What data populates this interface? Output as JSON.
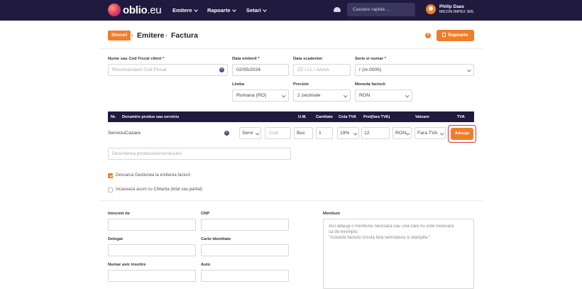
{
  "header": {
    "logo_main": "oblio",
    "logo_suffix": ".eu",
    "nav": [
      "Emitere",
      "Rapoarte",
      "Setari"
    ],
    "search_placeholder": "Cautare rapida ...",
    "user_name": "Philip Daas",
    "user_company": "MICON IMPEX SRL"
  },
  "breadcrumb": {
    "badge": "Stocuri",
    "items": [
      "Emitere",
      "Factura"
    ]
  },
  "actions": {
    "help": "?",
    "rapoarte_label": "Rapoarte"
  },
  "form": {
    "client": {
      "label": "Nume sau Cod Fiscal client *",
      "placeholder": "Recomandam Cod Fiscal"
    },
    "issue_date": {
      "label": "Data emiterii *",
      "value": "02/05/2024"
    },
    "due_date": {
      "label": "Data scadentei",
      "placeholder": "ZZ / LL / AAAA"
    },
    "series": {
      "label": "Serie si numar *",
      "value": "r (nr.0005)"
    },
    "language": {
      "label": "Limba",
      "value": "Romana (RO)"
    },
    "precision": {
      "label": "Precizie",
      "value": "2 zecimale"
    },
    "currency": {
      "label": "Moneda facturii",
      "value": "RON"
    }
  },
  "table": {
    "headers": [
      "Nr.",
      "Denumire produs sau serviciu",
      "U.M.",
      "Cantitate",
      "Cota TVA",
      "Pret(fara TVA)",
      "Valoare",
      "TVA"
    ],
    "row": {
      "name": "ServiciuCazare",
      "type": "Servi",
      "code": "Cod",
      "unit": "Buc",
      "quantity": "1",
      "vat_rate": "19%",
      "price": "12",
      "currency": "RON",
      "vat_mode": "Fara TVA",
      "add_label": "Adauga"
    },
    "description_placeholder": "Descrierea produsului/serviciului"
  },
  "options": {
    "discharge": "Descarca Gestiunea la emiterea facturii",
    "collect": "Incaseaza acum cu Chitanta (total sau partial)"
  },
  "footer": {
    "prepared_by": "Intocmit de",
    "cnp": "CNP",
    "delegate": "Delegat",
    "id_card": "Carte Identitate",
    "notice_no": "Numar aviz insotire",
    "auto": "Auto",
    "mentions_label": "Mentiuni",
    "mentions_placeholder_1": "Aici adaugi o mentiune necesara sau una care nu este necesara",
    "mentions_placeholder_2": "ca de exemplu:",
    "mentions_placeholder_3": "\"Aceasta factura circula fara semnatura si stampila.\""
  }
}
